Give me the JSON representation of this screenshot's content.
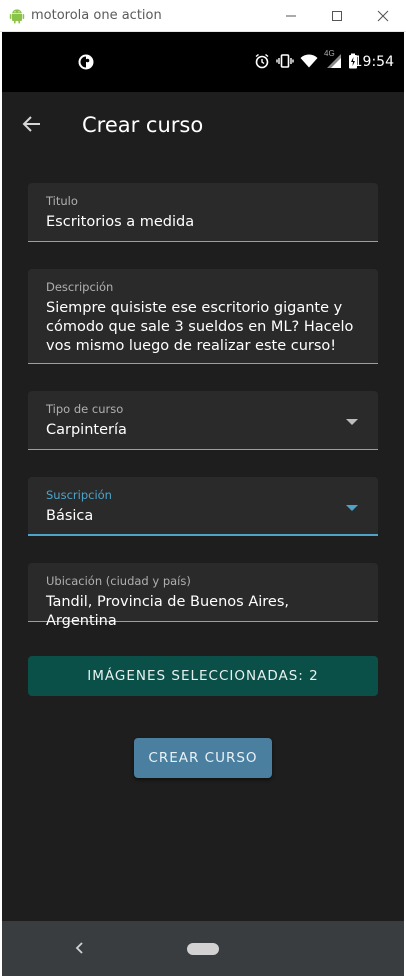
{
  "window": {
    "title": "motorola one action",
    "icons": [
      "android-icon",
      "minimize-icon",
      "maximize-icon",
      "close-icon"
    ]
  },
  "status_bar": {
    "time": "19:54",
    "network": "4G",
    "icons": [
      "app-notification-icon",
      "alarm-icon",
      "vibrate-icon",
      "wifi-icon",
      "signal-icon",
      "battery-icon"
    ]
  },
  "app_bar": {
    "title": "Crear curso",
    "back_icon": "arrow-left-icon"
  },
  "form": {
    "titulo": {
      "label": "Titulo",
      "value": "Escritorios a medida"
    },
    "descripcion": {
      "label": "Descripción",
      "value": "Siempre quisiste ese escritorio gigante y cómodo que sale 3 sueldos en ML? Hacelo vos mismo luego de realizar este curso!"
    },
    "tipo": {
      "label": "Tipo de curso",
      "value": "Carpintería"
    },
    "suscripcion": {
      "label": "Suscripción",
      "value": "Básica"
    },
    "ubicacion": {
      "label": "Ubicación (ciudad y país)",
      "value": "Tandil, Provincia de Buenos Aires, Argentina"
    }
  },
  "buttons": {
    "images": "IMÁGENES SELECCIONADAS: 2",
    "create": "CREAR CURSO"
  },
  "colors": {
    "background": "#1e1e1e",
    "field": "#2a2a2a",
    "accent": "#4ea3c8",
    "images_button": "#0a4f48",
    "create_button": "#4a7fa0"
  }
}
